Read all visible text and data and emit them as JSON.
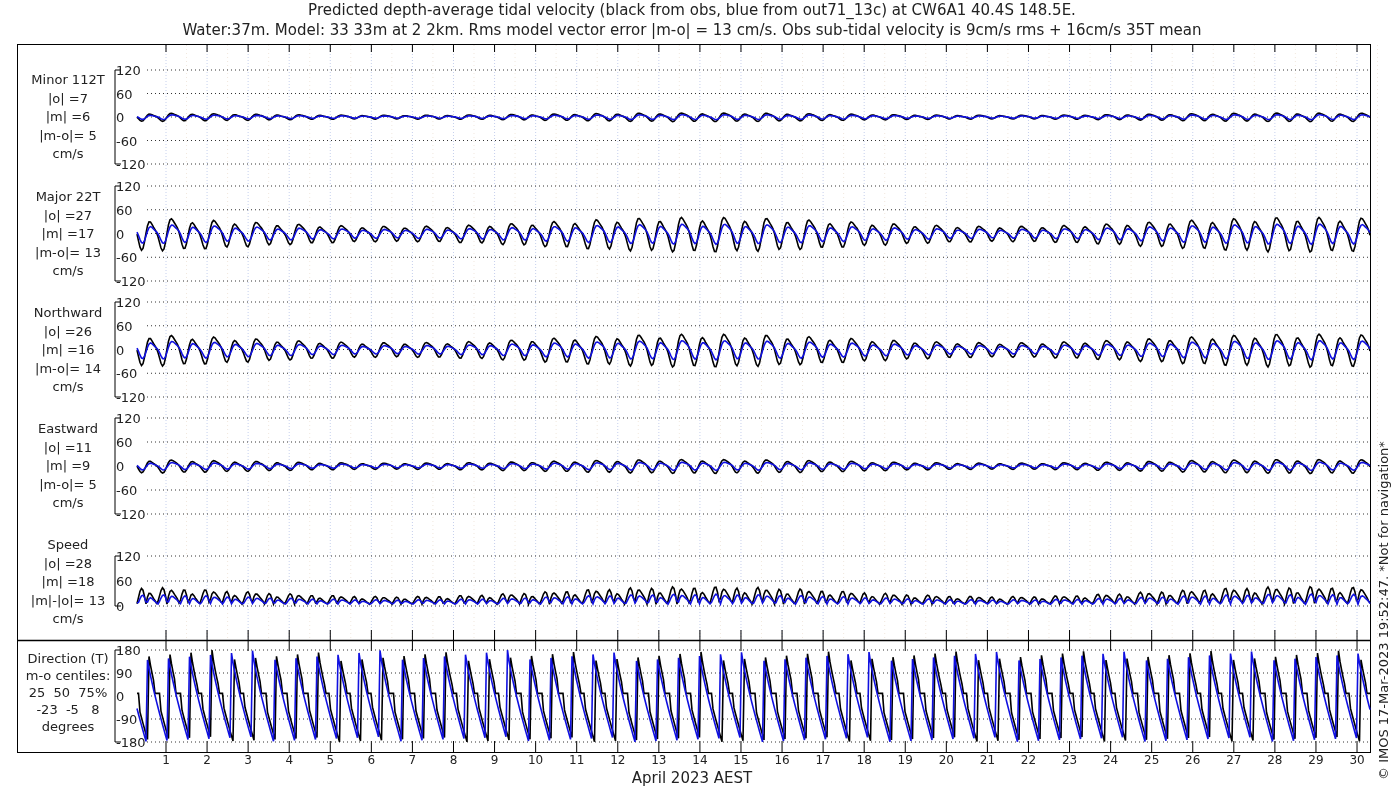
{
  "title": [
    "Predicted depth-average tidal velocity (black from obs, blue from out71_13c) at CW6A1 40.4S 148.5E.",
    "Water:37m. Model: 33 33m at 2 2km. Rms model vector error |m-o| = 13 cm/s. Obs sub-tidal velocity is 9cm/s rms + 16cm/s 35T mean"
  ],
  "panels": [
    {
      "kind": "signed",
      "label_lines": [
        "Minor 112T",
        "|o| =7",
        "|m| =6",
        "|m-o|= 5",
        "cm/s"
      ],
      "yticks": [
        "120",
        "60",
        "0",
        "-60",
        "-120"
      ]
    },
    {
      "kind": "signed",
      "label_lines": [
        "Major 22T",
        "|o| =27",
        "|m| =17",
        "|m-o|= 13",
        "cm/s"
      ],
      "yticks": [
        "120",
        "60",
        "0",
        "-60",
        "-120"
      ]
    },
    {
      "kind": "signed",
      "label_lines": [
        "Northward",
        "|o| =26",
        "|m| =16",
        "|m-o|= 14",
        "cm/s"
      ],
      "yticks": [
        "120",
        "60",
        "0",
        "-60",
        "-120"
      ]
    },
    {
      "kind": "signed",
      "label_lines": [
        "Eastward",
        "|o| =11",
        "|m| =9",
        "|m-o|= 5",
        "cm/s"
      ],
      "yticks": [
        "120",
        "60",
        "0",
        "-60",
        "-120"
      ]
    },
    {
      "kind": "speed",
      "label_lines": [
        "Speed",
        "|o| =28",
        "|m| =18",
        "|m|-|o|= 13",
        "cm/s"
      ],
      "yticks": [
        "120",
        "60",
        "0"
      ]
    },
    {
      "kind": "direction",
      "label_lines": [
        "Direction (T)",
        "m-o centiles:",
        "25  50  75%",
        "-23  -5   8",
        "degrees"
      ],
      "yticks": [
        "180",
        "90",
        "0",
        "-90",
        "-180"
      ]
    }
  ],
  "xticks": [
    "1",
    "2",
    "3",
    "4",
    "5",
    "6",
    "7",
    "8",
    "9",
    "10",
    "11",
    "12",
    "13",
    "14",
    "15",
    "16",
    "17",
    "18",
    "19",
    "20",
    "21",
    "22",
    "23",
    "24",
    "25",
    "26",
    "27",
    "28",
    "29",
    "30"
  ],
  "xlabel": "April 2023 AEST",
  "side_note": "© IMOS 17-Mar-2023 19:52:47. *Not for navigation*"
}
